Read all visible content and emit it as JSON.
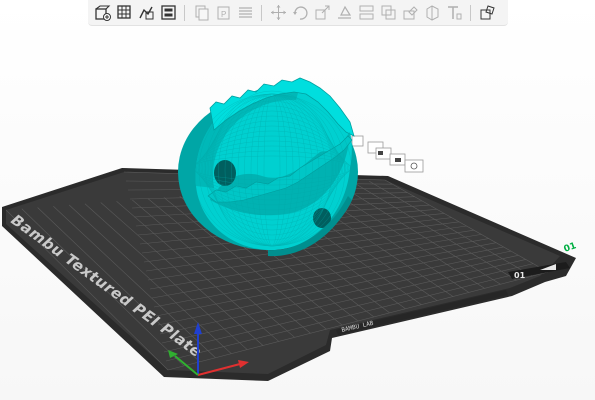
{
  "toolbar": {
    "groups": [
      [
        "add-object-icon",
        "arrange-grid-icon",
        "auto-orient-icon",
        "layer-view-icon"
      ],
      [
        "copy-icon",
        "paste-icon",
        "layers-list-icon"
      ],
      [
        "move-icon",
        "rotate-icon",
        "scale-icon",
        "lay-on-face-icon",
        "cut-icon",
        "boolean-icon",
        "support-paint-icon",
        "seam-icon",
        "text-icon"
      ],
      [
        "assembly-view-icon"
      ]
    ],
    "disabled": [
      "copy-icon",
      "paste-icon",
      "layers-list-icon",
      "move-icon",
      "rotate-icon",
      "scale-icon",
      "lay-on-face-icon",
      "cut-icon",
      "boolean-icon",
      "support-paint-icon",
      "seam-icon",
      "text-icon"
    ]
  },
  "plate": {
    "name": "Bambu Textured PEI Plate",
    "number": "01",
    "small_label": "BAMBU LAB",
    "corner_label": "01",
    "surface_color": "#3a3a3a",
    "grid_color": "#5a5a5a",
    "accent_color": "#00ae42"
  },
  "model": {
    "color": "#00cccc",
    "shade_color": "#00a6a6"
  },
  "axes": {
    "x_color": "#e03030",
    "y_color": "#30b030",
    "z_color": "#2040d0"
  }
}
